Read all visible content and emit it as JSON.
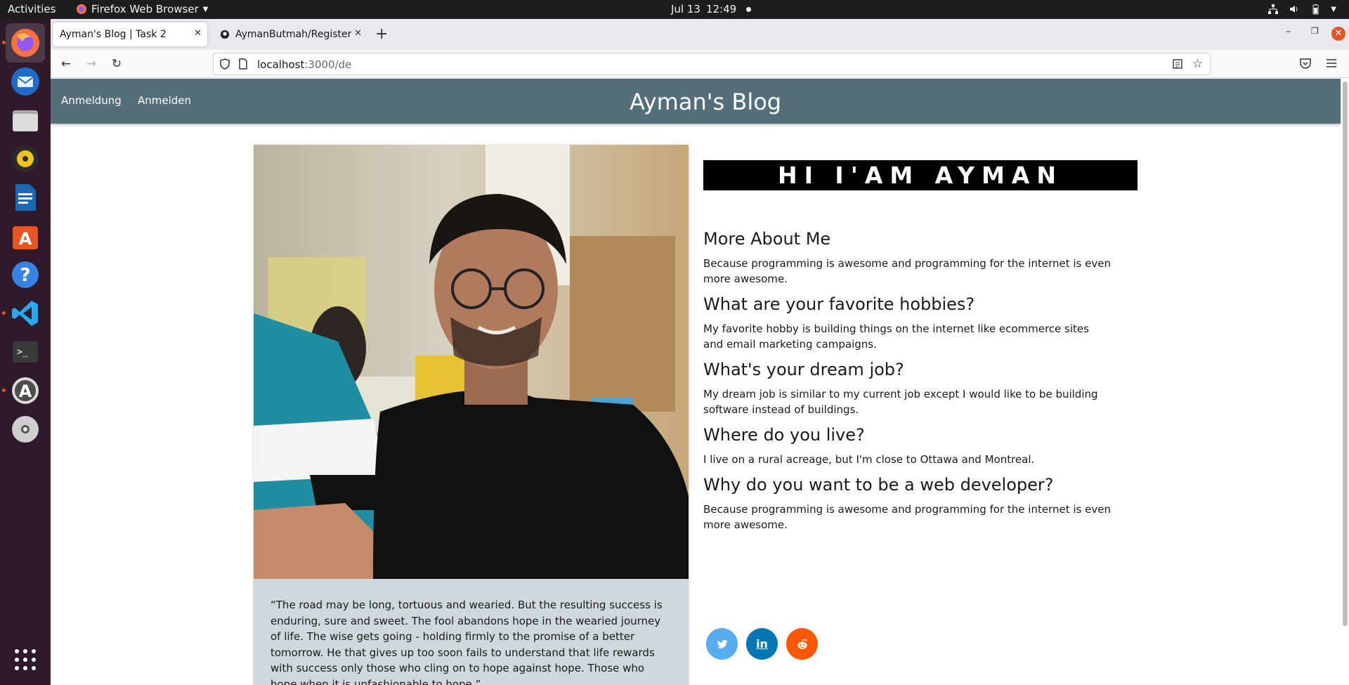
{
  "topbar": {
    "activities": "Activities",
    "app_menu": "Firefox Web Browser",
    "date": "Jul 13",
    "time": "12:49"
  },
  "dock": {
    "items": [
      "firefox-icon",
      "thunderbird-icon",
      "files-icon",
      "rhythmbox-icon",
      "writer-icon",
      "software-center-icon",
      "help-icon",
      "vscode-icon",
      "terminal-icon",
      "software-updater-icon",
      "dvd-icon",
      "show-apps-icon"
    ]
  },
  "browser": {
    "tabs": [
      {
        "title": "Ayman's Blog | Task 2"
      },
      {
        "title": "AymanButmah/Register-L"
      }
    ],
    "url_host": "localhost",
    "url_path": ":3000/de"
  },
  "site": {
    "nav_links": [
      "Anmeldung",
      "Anmelden"
    ],
    "brand": "Ayman's Blog",
    "hero_title": "HI I'AM AYMAN",
    "quote": "“The road may be long, tortuous and wearied. But the resulting success is enduring, sure and sweet. The fool abandons hope in the wearied journey of life. The wise gets going - holding firmly to the promise of a better tomorrow. He that gives up too soon fails to understand that life rewards with success only those who cling on to hope against hope. Those who hope when it is unfashionable to hope.”",
    "sections": [
      {
        "heading": "More About Me",
        "text": "Because programming is awesome and programming for the internet is even more awesome."
      },
      {
        "heading": "What are your favorite hobbies?",
        "text": "My favorite hobby is building things on the internet like ecommerce sites and email marketing campaigns."
      },
      {
        "heading": "What's your dream job?",
        "text": "My dream job is similar to my current job except I would like to be building software instead of buildings."
      },
      {
        "heading": "Where do you live?",
        "text": "I live on a rural acreage, but I'm close to Ottawa and Montreal."
      },
      {
        "heading": "Why do you want to be a web developer?",
        "text": "Because programming is awesome and programming for the internet is even more awesome."
      }
    ],
    "social": [
      {
        "name": "twitter",
        "label": "",
        "color": "#55acee"
      },
      {
        "name": "linkedin",
        "label": "in",
        "color": "#0077b5"
      },
      {
        "name": "reddit",
        "label": "",
        "color": "#ff5700"
      }
    ]
  }
}
